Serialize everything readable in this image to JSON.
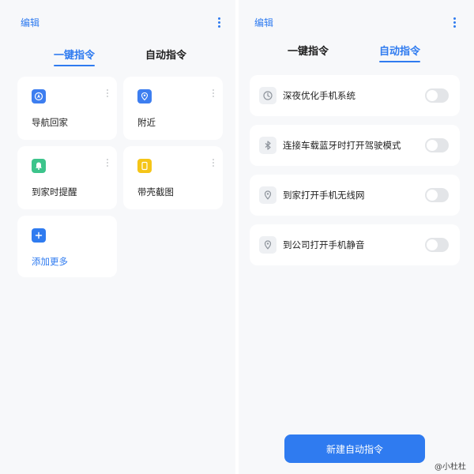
{
  "left_panel": {
    "edit_label": "编辑",
    "tabs": [
      {
        "label": "一键指令",
        "active": true
      },
      {
        "label": "自动指令",
        "active": false
      }
    ],
    "cards": [
      {
        "label": "导航回家",
        "icon": "navigation-icon",
        "icon_color": "#3d7ef0"
      },
      {
        "label": "附近",
        "icon": "location-pin-icon",
        "icon_color": "#3d7ef0"
      },
      {
        "label": "到家时提醒",
        "icon": "home-reminder-icon",
        "icon_color": "#3cc48b"
      },
      {
        "label": "带壳截图",
        "icon": "phone-frame-icon",
        "icon_color": "#f5c518"
      },
      {
        "label": "添加更多",
        "icon": "plus-icon",
        "icon_color": "#2f7bf0"
      }
    ]
  },
  "right_panel": {
    "edit_label": "编辑",
    "tabs": [
      {
        "label": "一键指令",
        "active": false
      },
      {
        "label": "自动指令",
        "active": true
      }
    ],
    "rows": [
      {
        "label": "深夜优化手机系统",
        "icon": "clock-icon",
        "enabled": false
      },
      {
        "label": "连接车载蓝牙时打开驾驶模式",
        "icon": "bluetooth-icon",
        "enabled": false
      },
      {
        "label": "到家打开手机无线网",
        "icon": "location-pin-icon",
        "enabled": false
      },
      {
        "label": "到公司打开手机静音",
        "icon": "location-pin-icon",
        "enabled": false
      }
    ],
    "new_button_label": "新建自动指令"
  },
  "watermark": "@小杜杜",
  "colors": {
    "accent": "#2f7bf0",
    "background": "#f7f8fa",
    "card": "#ffffff",
    "toggle_off": "#e3e5e8"
  }
}
